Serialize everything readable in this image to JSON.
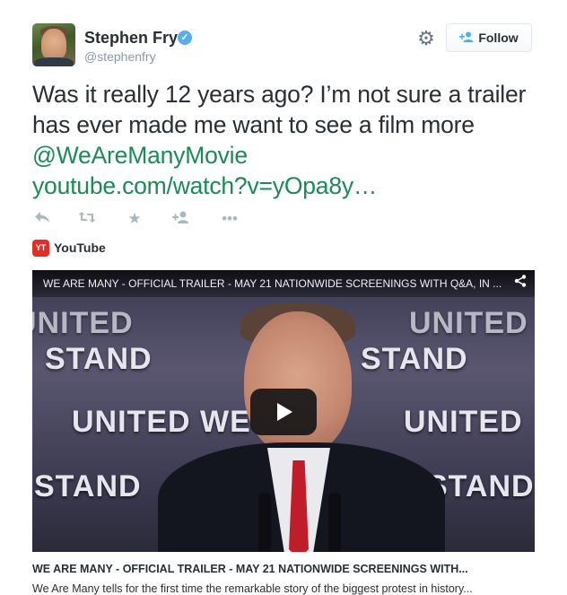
{
  "author": {
    "name": "Stephen Fry",
    "handle": "@stephenfry",
    "verified_glyph": "✓"
  },
  "header": {
    "follow_label": "Follow",
    "follow_icon": "add-person-icon",
    "settings_icon": "gear-icon"
  },
  "tweet": {
    "text_before": "Was it really 12 years ago? I’m not sure a trailer has ever made me want to see a film more ",
    "mention": "@WeAreManyMovie",
    "url": "youtube.com/watch?v=yOpa8y…"
  },
  "actions": {
    "reply_icon": "reply-icon",
    "retweet_icon": "retweet-icon",
    "favorite_icon": "star-icon",
    "follow_icon": "add-person-icon",
    "more_icon": "more-dots-icon"
  },
  "card": {
    "source": "YouTube",
    "source_logo_text": "YT",
    "video_title": "WE ARE MANY - OFFICIAL TRAILER - MAY 21 NATIONWIDE SCREENINGS WITH Q&A, IN ...",
    "title": "WE ARE MANY - OFFICIAL TRAILER - MAY 21 NATIONWIDE SCREENINGS WITH...",
    "description": "We Are Many tells for the first time the remarkable story of the biggest protest in history...",
    "backdrop_words": [
      "STAND",
      "UNITED WE",
      "STAND",
      "UNITED",
      "STAND",
      "UNITED",
      "STAND",
      "STAND"
    ]
  },
  "colors": {
    "link_green": "#1b8a57",
    "verified_blue": "#55acee",
    "youtube_red": "#e52d27",
    "icon_gray": "#aab8c2"
  }
}
